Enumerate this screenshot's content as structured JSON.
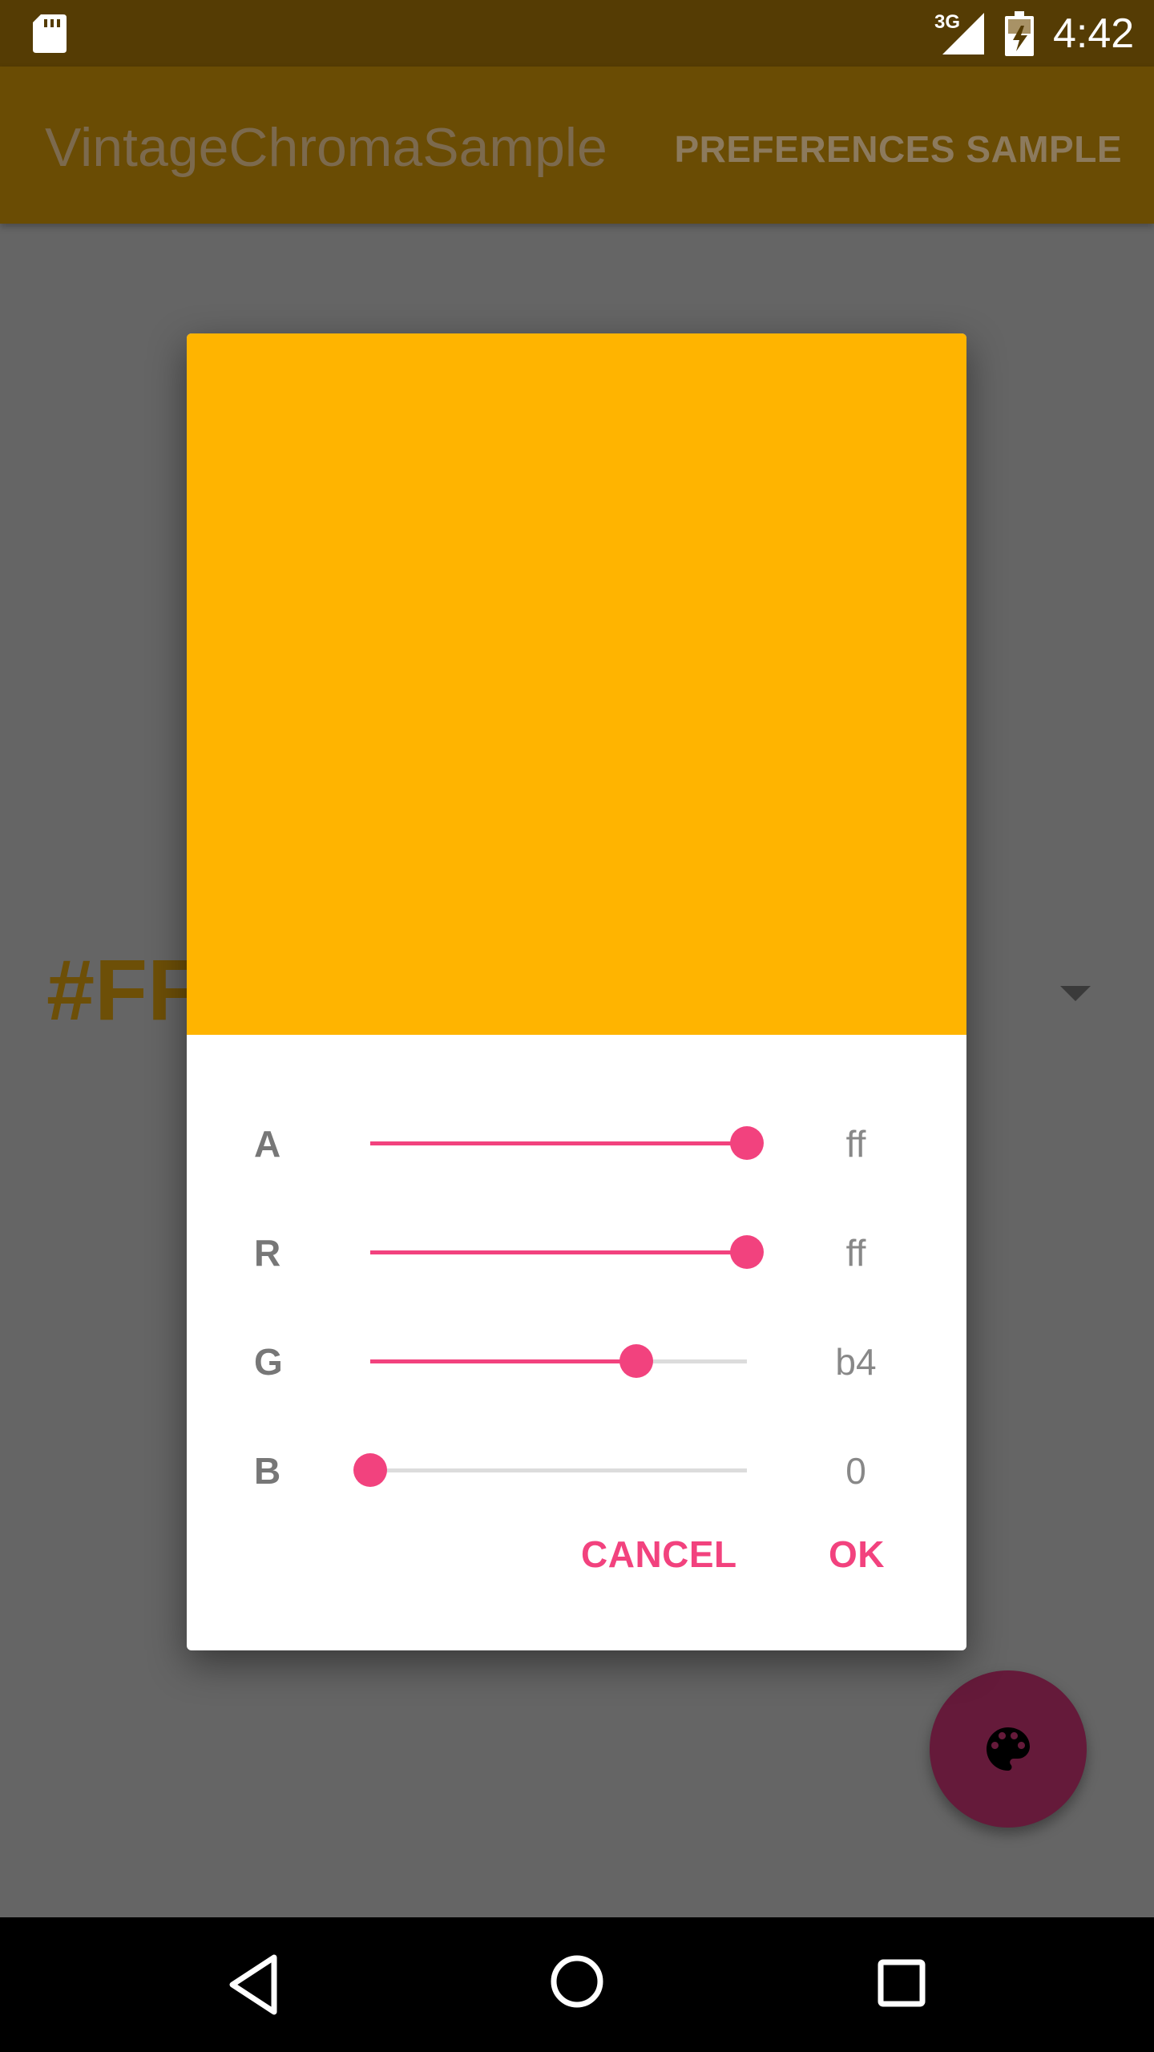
{
  "status_bar": {
    "network": "3G",
    "time": "4:42",
    "icons": [
      "sd-card-icon",
      "signal-icon",
      "battery-charging-icon"
    ]
  },
  "app_bar": {
    "title": "VintageChromaSample",
    "action": "PREFERENCES SAMPLE"
  },
  "background": {
    "hex_text": "#FF"
  },
  "dialog": {
    "preview_color": "#ffb400",
    "channels": [
      {
        "label": "A",
        "value": "ff",
        "level": 1.0
      },
      {
        "label": "R",
        "value": "ff",
        "level": 1.0
      },
      {
        "label": "G",
        "value": "b4",
        "level": 0.706
      },
      {
        "label": "B",
        "value": "0",
        "level": 0.0
      }
    ],
    "cancel_label": "CANCEL",
    "ok_label": "OK"
  },
  "fab": {
    "icon": "palette-icon"
  },
  "nav_bar": {
    "icons": [
      "back-icon",
      "home-icon",
      "recents-icon"
    ]
  },
  "colors": {
    "accent": "#f2427e",
    "status_bar": "#553c04",
    "app_bar": "#6a4c04",
    "scrim_background": "#656565",
    "fab": "#651a3a"
  }
}
